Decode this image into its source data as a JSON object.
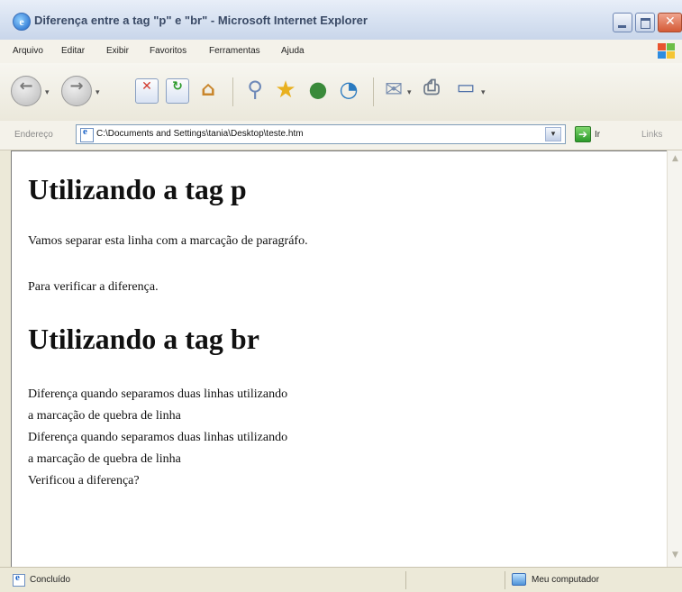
{
  "window": {
    "title": "Diferença entre a tag \"p\" e \"br\" - Microsoft Internet Explorer"
  },
  "menu": {
    "items": [
      "Arquivo",
      "Editar",
      "Exibir",
      "Favoritos",
      "Ferramentas",
      "Ajuda"
    ]
  },
  "toolbar": {
    "buttons": [
      "back-icon",
      "forward-icon",
      "stop-icon",
      "refresh-icon",
      "home-icon",
      "search-icon",
      "favorites-star-icon",
      "media-icon",
      "history-icon",
      "mail-icon",
      "print-icon",
      "edit-icon"
    ]
  },
  "address": {
    "label": "Endereço",
    "value": "C:\\Documents and Settings\\tania\\Desktop\\teste.htm",
    "go_label": "Ir",
    "links_label": "Links"
  },
  "document": {
    "heading1": "Utilizando a tag p",
    "para1": "Vamos separar esta linha com a marcação de paragráfo.",
    "para2": "Para verificar a diferença.",
    "heading2": "Utilizando a tag br",
    "lines": [
      "Diferença quando separamos duas linhas utilizando",
      "a marcação de quebra de linha",
      "Diferença quando separamos duas linhas utilizando",
      "a marcação de quebra de linha",
      "Verificou a diferença?"
    ]
  },
  "status": {
    "text": "Concluído",
    "zone": "Meu computador"
  },
  "colors": {
    "title_bar": "#d9e3f2",
    "chrome": "#ece9d8",
    "close_button": "#d45a36",
    "go_button": "#2c9a2a"
  }
}
